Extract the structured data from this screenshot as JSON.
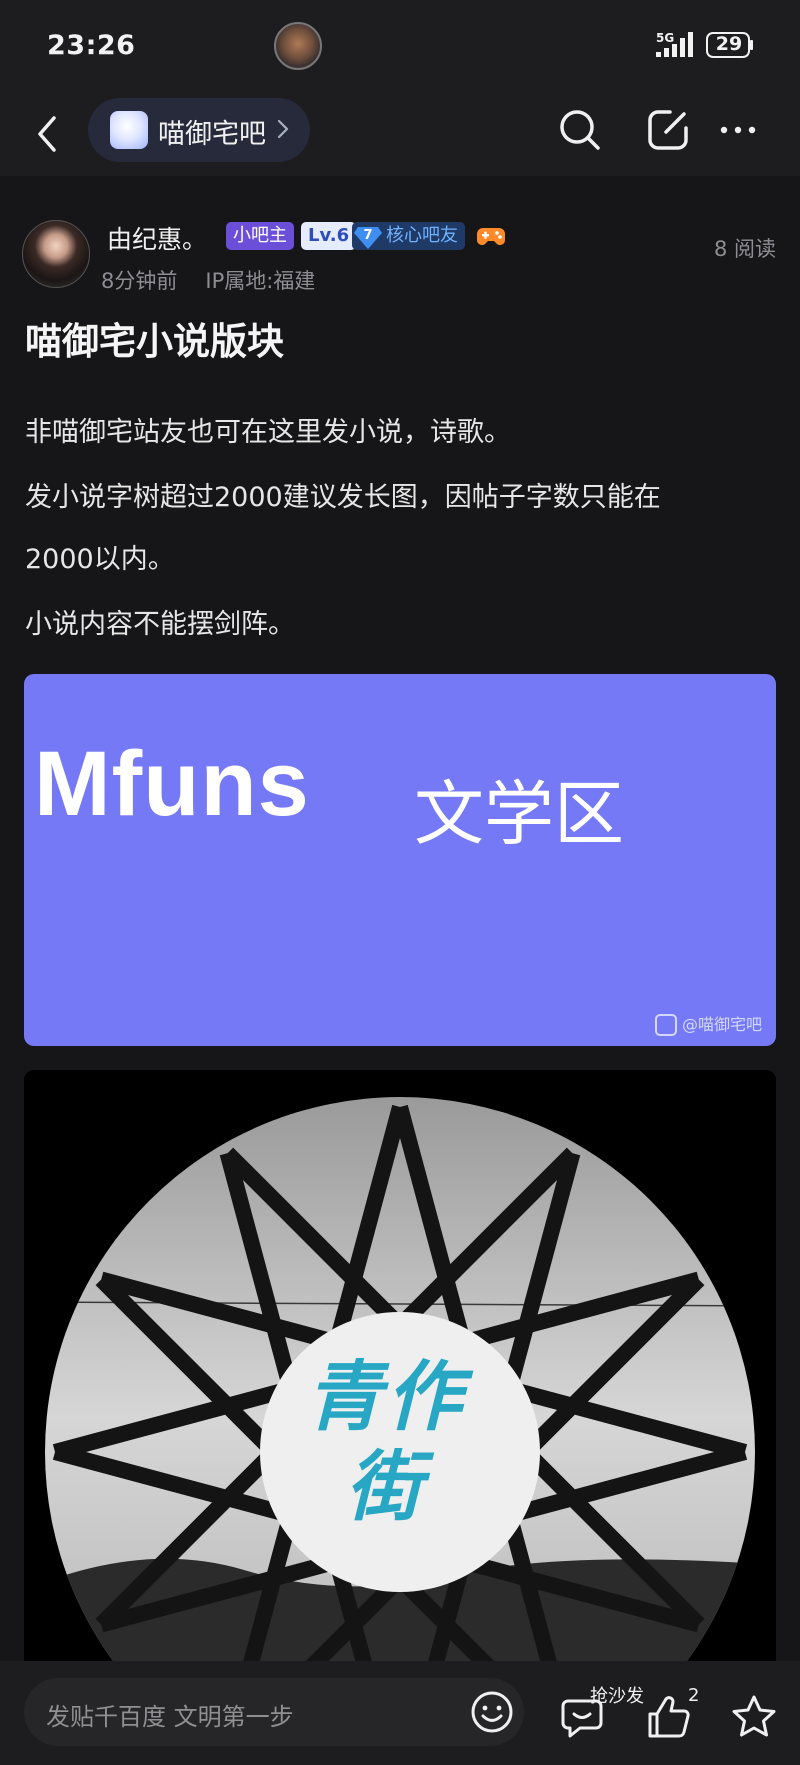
{
  "status_bar": {
    "time": "23:26",
    "network": "5G",
    "battery": "29"
  },
  "header": {
    "forum_name": "喵御宅吧",
    "forum_arrow": "›"
  },
  "post": {
    "author": "由纪惠。",
    "badges": {
      "owner": "小吧主",
      "level": "Lv.6",
      "core_level": "7",
      "core_label": "核心吧友"
    },
    "reads": "8 阅读",
    "time_ago": "8分钟前",
    "ip_location": "IP属地:福建",
    "title": "喵御宅小说版块",
    "paragraphs": [
      "非喵御宅站友也可在这里发小说，诗歌。",
      "发小说字树超过2000建议发长图，因帖子字数只能在",
      "2000以内。",
      "小说内容不能摆剑阵。"
    ],
    "image1": {
      "text_latin": "Mfuns",
      "text_cjk": "文学区",
      "watermark": "@喵御宅吧"
    },
    "image2": {
      "text_line1": "青作",
      "text_line2": "街"
    }
  },
  "bottom_bar": {
    "input_placeholder": "发贴千百度 文明第一步",
    "sofa_label": "抢沙发",
    "like_count": "2"
  },
  "colors": {
    "background": "#161618",
    "banner": "#7579f6",
    "accent_owner": "#6b4fd8",
    "accent_core": "#6fb2ff"
  }
}
